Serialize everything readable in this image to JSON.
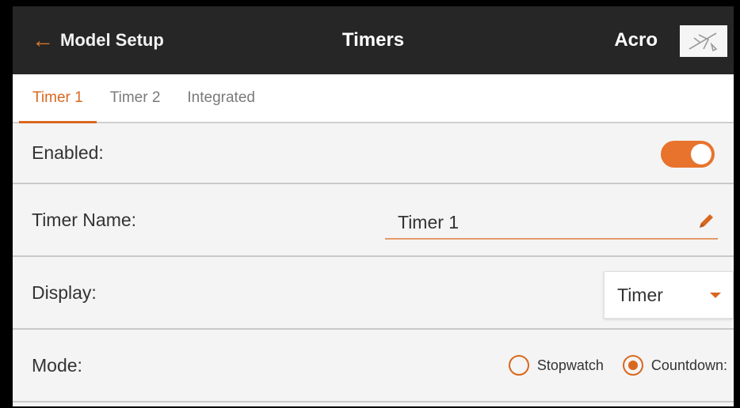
{
  "header": {
    "back_label": "Model Setup",
    "title": "Timers",
    "model_name": "Acro",
    "model_icon": "airplane-icon"
  },
  "tabs": [
    {
      "label": "Timer 1",
      "active": true
    },
    {
      "label": "Timer 2",
      "active": false
    },
    {
      "label": "Integrated",
      "active": false
    }
  ],
  "enabled": {
    "label": "Enabled:",
    "value": true
  },
  "timer_name": {
    "label": "Timer Name:",
    "value": "Timer 1"
  },
  "display": {
    "label": "Display:",
    "selected": "Timer"
  },
  "mode": {
    "label": "Mode:",
    "options": [
      {
        "label": "Stopwatch",
        "selected": false
      },
      {
        "label": "Countdown:",
        "selected": true
      }
    ]
  },
  "colors": {
    "accent": "#e8732c",
    "header_bg": "#262626",
    "body_bg": "#f4f4f4"
  }
}
